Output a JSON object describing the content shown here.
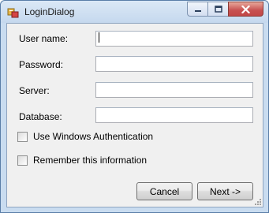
{
  "window": {
    "title": "LoginDialog",
    "icon": "app-form-icon",
    "controls": [
      "minimize-icon",
      "maximize-icon",
      "close-icon"
    ],
    "colors": {
      "frame": "#c9dcf0",
      "close": "#c75050",
      "client": "#f0f0f0"
    }
  },
  "form": {
    "fields": [
      {
        "label": "User name:",
        "value": ""
      },
      {
        "label": "Password:",
        "value": ""
      },
      {
        "label": "Server:",
        "value": ""
      },
      {
        "label": "Database:",
        "value": ""
      }
    ],
    "checkboxes": [
      {
        "label": "Use Windows Authentication",
        "checked": false
      },
      {
        "label": "Remember this information",
        "checked": false
      }
    ]
  },
  "buttons": {
    "cancel": "Cancel",
    "next": "Next ->"
  }
}
